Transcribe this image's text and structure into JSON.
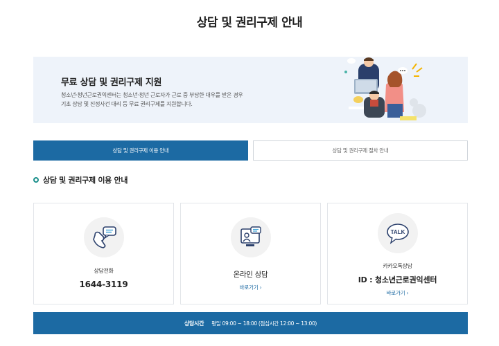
{
  "page": {
    "title": "상담 및 권리구제 안내"
  },
  "banner": {
    "heading": "무료 상담 및 권리구제 지원",
    "desc_line1": "청소년·청년근로권익센터는 청소년·청년 근로자가 근로 중 부당한 대우를 받은 경우",
    "desc_line2": "기초 상담 및 진정사건 대리 등 무료 권리구제를 지원합니다."
  },
  "tabs": [
    {
      "label": "상담 및 권리구제 이용 안내",
      "active": true
    },
    {
      "label": "상담 및 권리구제 절차 안내",
      "active": false
    }
  ],
  "section": {
    "heading": "상담 및 권리구제 이용 안내"
  },
  "cards": [
    {
      "label": "상담전화",
      "value": "1644-3119",
      "icon": "phone-chat-icon"
    },
    {
      "title": "온라인 상담",
      "link": "바로가기 ›",
      "icon": "online-counsel-icon"
    },
    {
      "label": "카카오톡상담",
      "value": "ID : 청소년근로권익센터",
      "link": "바로가기 ›",
      "icon": "kakaotalk-icon",
      "icon_text": "TALK"
    }
  ],
  "hours": {
    "label": "상담시간",
    "text": "평일 09:00 ~ 18:00 (점심시간 12:00 ~ 13:00)"
  },
  "colors": {
    "primary": "#1c6aa3",
    "banner_bg": "#eef3fa",
    "accent": "#1b8f8b"
  }
}
